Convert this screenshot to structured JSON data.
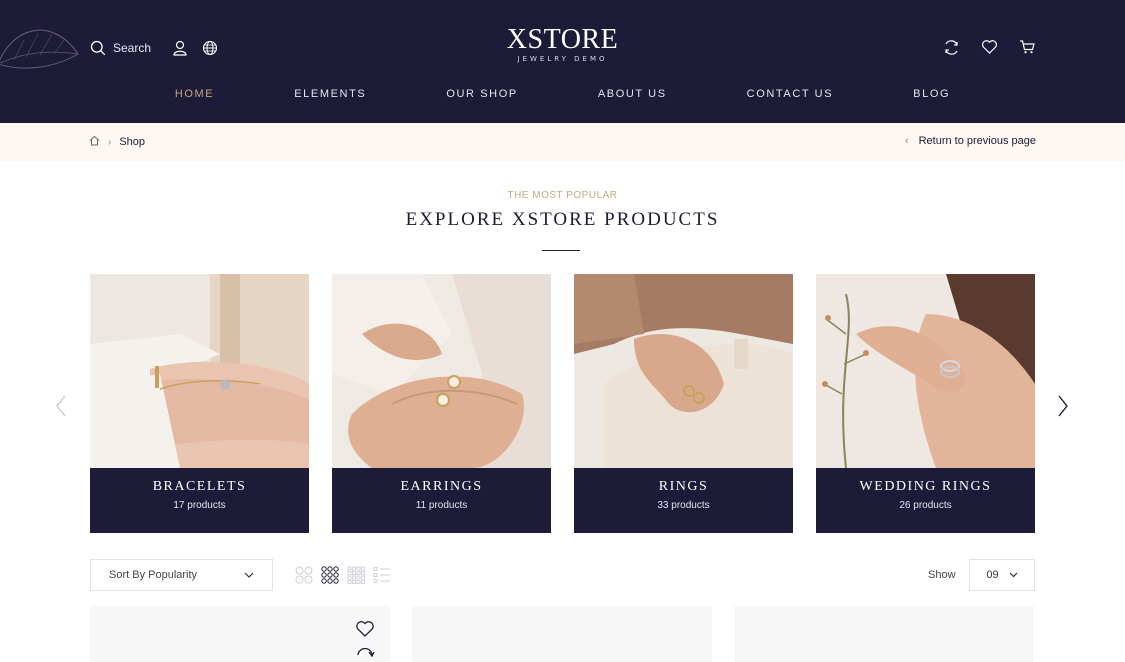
{
  "header": {
    "brand": "XSTORE",
    "brand_sub": "JEWELRY DEMO",
    "search_label": "Search",
    "background": "#1c1b38",
    "accent": "#c8a97a"
  },
  "nav": {
    "items": [
      {
        "label": "HOME",
        "active": true
      },
      {
        "label": "ELEMENTS",
        "active": false
      },
      {
        "label": "OUR SHOP",
        "active": false
      },
      {
        "label": "ABOUT US",
        "active": false
      },
      {
        "label": "CONTACT US",
        "active": false
      },
      {
        "label": "BLOG",
        "active": false
      }
    ]
  },
  "breadcrumb": {
    "current": "Shop",
    "back_label": "Return to previous page"
  },
  "section": {
    "kicker": "THE MOST POPULAR",
    "title": "EXPLORE XSTORE PRODUCTS"
  },
  "categories": [
    {
      "name": "BRACELETS",
      "count": "17 products"
    },
    {
      "name": "EARRINGS",
      "count": "11 products"
    },
    {
      "name": "RINGS",
      "count": "33 products"
    },
    {
      "name": "WEDDING RINGS",
      "count": "26 products"
    }
  ],
  "toolbar": {
    "sort_value": "Sort By Popularity",
    "show_label": "Show",
    "show_value": "09"
  }
}
